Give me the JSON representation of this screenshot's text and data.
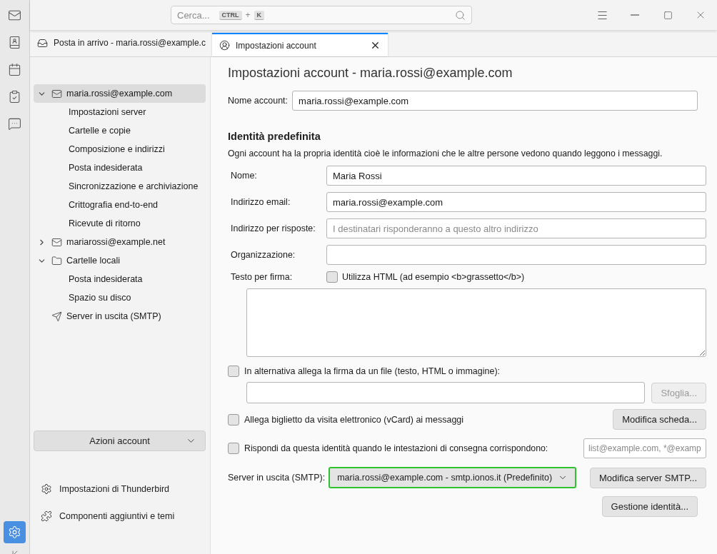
{
  "spaces_toolbar": [
    {
      "kind": "mail",
      "selected": false
    },
    {
      "kind": "address-book",
      "selected": false
    },
    {
      "kind": "calendar",
      "selected": false
    },
    {
      "kind": "tasks",
      "selected": false
    },
    {
      "kind": "chat",
      "selected": false
    },
    {
      "kind": "settings",
      "selected": true
    }
  ],
  "search": {
    "placeholder": "Cerca...",
    "keys": [
      "CTRL",
      "K"
    ],
    "joiner": "+"
  },
  "tabs": [
    {
      "kind": "inbox",
      "label": "Posta in arrivo - maria.rossi@example.c",
      "selected": false
    },
    {
      "kind": "account",
      "label": "Impostazioni account",
      "selected": true
    }
  ],
  "account_tree": [
    {
      "kind": "account",
      "label": "maria.rossi@example.com",
      "expanded": true,
      "selected": true,
      "children": [
        {
          "label": "Impostazioni server"
        },
        {
          "label": "Cartelle e copie"
        },
        {
          "label": "Composizione e indirizzi"
        },
        {
          "label": "Posta indesiderata"
        },
        {
          "label": "Sincronizzazione e archiviazione"
        },
        {
          "label": "Crittografia end-to-end"
        },
        {
          "label": "Ricevute di ritorno"
        }
      ]
    },
    {
      "kind": "account",
      "label": "mariarossi@example.net",
      "expanded": false,
      "selected": false
    },
    {
      "kind": "folder",
      "label": "Cartelle locali",
      "expanded": true,
      "selected": false,
      "children": [
        {
          "label": "Posta indesiderata"
        },
        {
          "label": "Spazio su disco"
        }
      ]
    },
    {
      "kind": "outgoing",
      "label": "Server in uscita (SMTP)",
      "selected": false
    }
  ],
  "account_actions": {
    "label": "Azioni account"
  },
  "footer_links": [
    {
      "kind": "settings",
      "label": "Impostazioni di Thunderbird"
    },
    {
      "kind": "addons",
      "label": "Componenti aggiuntivi e temi"
    }
  ],
  "settings": {
    "title": "Impostazioni account - maria.rossi@example.com",
    "account_name": {
      "label": "Nome account:",
      "value": "maria.rossi@example.com"
    },
    "identity_heading": "Identità predefinita",
    "identity_description": "Ogni account ha la propria identità cioè le informazioni che le altre persone vedono quando leggono i messaggi.",
    "fields": [
      {
        "label": "Nome:",
        "value": "Maria Rossi"
      },
      {
        "label": "Indirizzo email:",
        "value": "maria.rossi@example.com"
      },
      {
        "label": "Indirizzo per risposte:",
        "placeholder": "I destinatari risponderanno a questo altro indirizzo"
      },
      {
        "label": "Organizzazione:"
      }
    ],
    "signature": {
      "label": "Testo per firma:",
      "html_checkbox": {
        "label": "Utilizza HTML (ad esempio <b>grassetto</b>)",
        "checked": false
      }
    },
    "attach_file": {
      "label": "In alternativa allega la firma da un file (testo, HTML o immagine):",
      "checked": false,
      "browse_button": "Sfoglia...",
      "browse_disabled": true
    },
    "vcard": {
      "label": "Allega biglietto da visita elettronico (vCard) ai messaggi",
      "checked": false,
      "button": "Modifica scheda..."
    },
    "reply_from": {
      "label": "Rispondi da questa identità quando le intestazioni di consegna corrispondono:",
      "checked": false,
      "placeholder": "list@example.com, *@examp"
    },
    "smtp": {
      "label": "Server in uscita (SMTP):",
      "value": "maria.rossi@example.com - smtp.ionos.it (Predefinito)",
      "highlighted": true,
      "button": "Modifica server SMTP..."
    },
    "manage_button": "Gestione identità..."
  }
}
